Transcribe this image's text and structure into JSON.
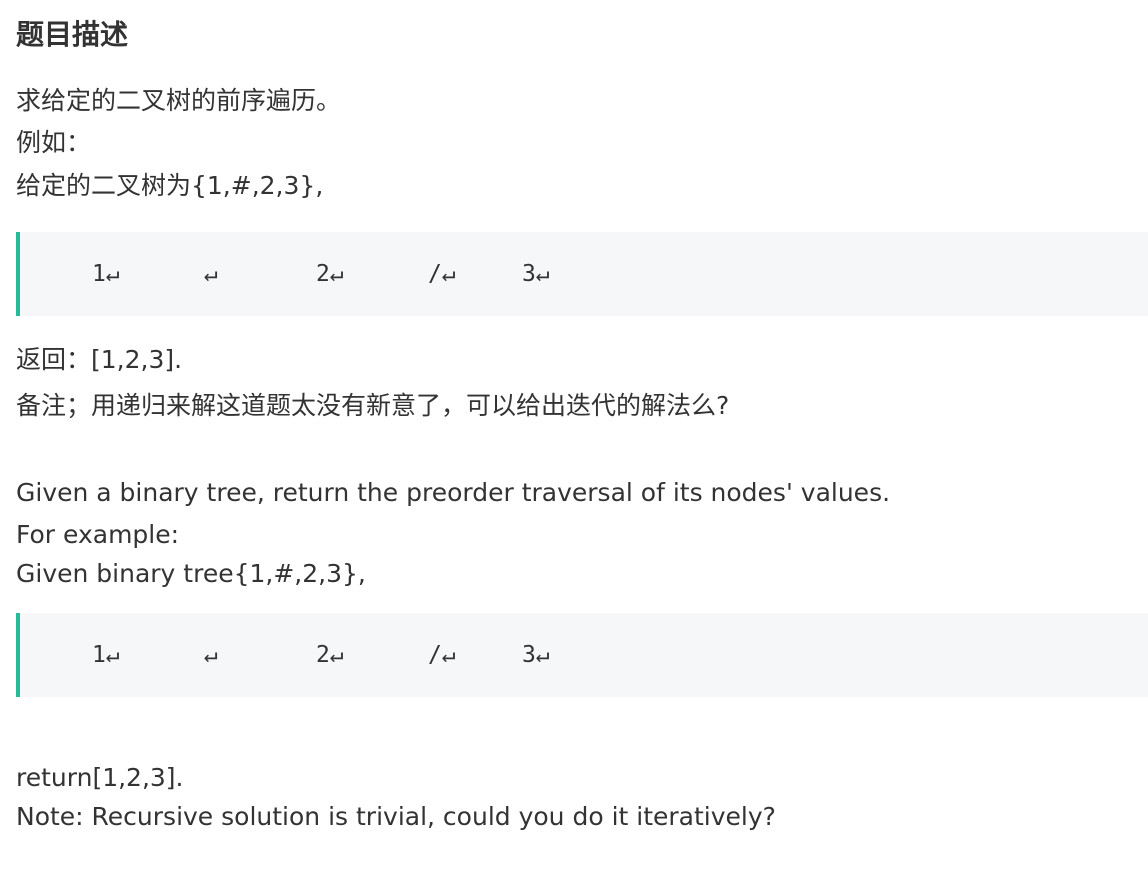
{
  "title": "题目描述",
  "zh": {
    "line1": "求给定的二叉树的前序遍历。",
    "line2": "例如：",
    "line3": "给定的二叉树为{1,#,2,3},",
    "code": [
      "1↵",
      "↵",
      "2↵",
      "/↵",
      "3↵"
    ],
    "line4": "返回：[1,2,3].",
    "line5": "备注；用递归来解这道题太没有新意了，可以给出迭代的解法么?"
  },
  "en": {
    "line1": "Given a binary tree, return the preorder traversal of its nodes' values.",
    "line2": "For example:",
    "line3": "Given binary tree{1,#,2,3},",
    "code": [
      "1↵",
      "↵",
      "2↵",
      "/↵",
      "3↵"
    ],
    "line4": "return[1,2,3].",
    "line5": "Note: Recursive solution is trivial, could you do it iteratively?"
  },
  "colors": {
    "text": "#333333",
    "code_background": "#f6f7f8",
    "accent_border": "#25bb9b"
  }
}
